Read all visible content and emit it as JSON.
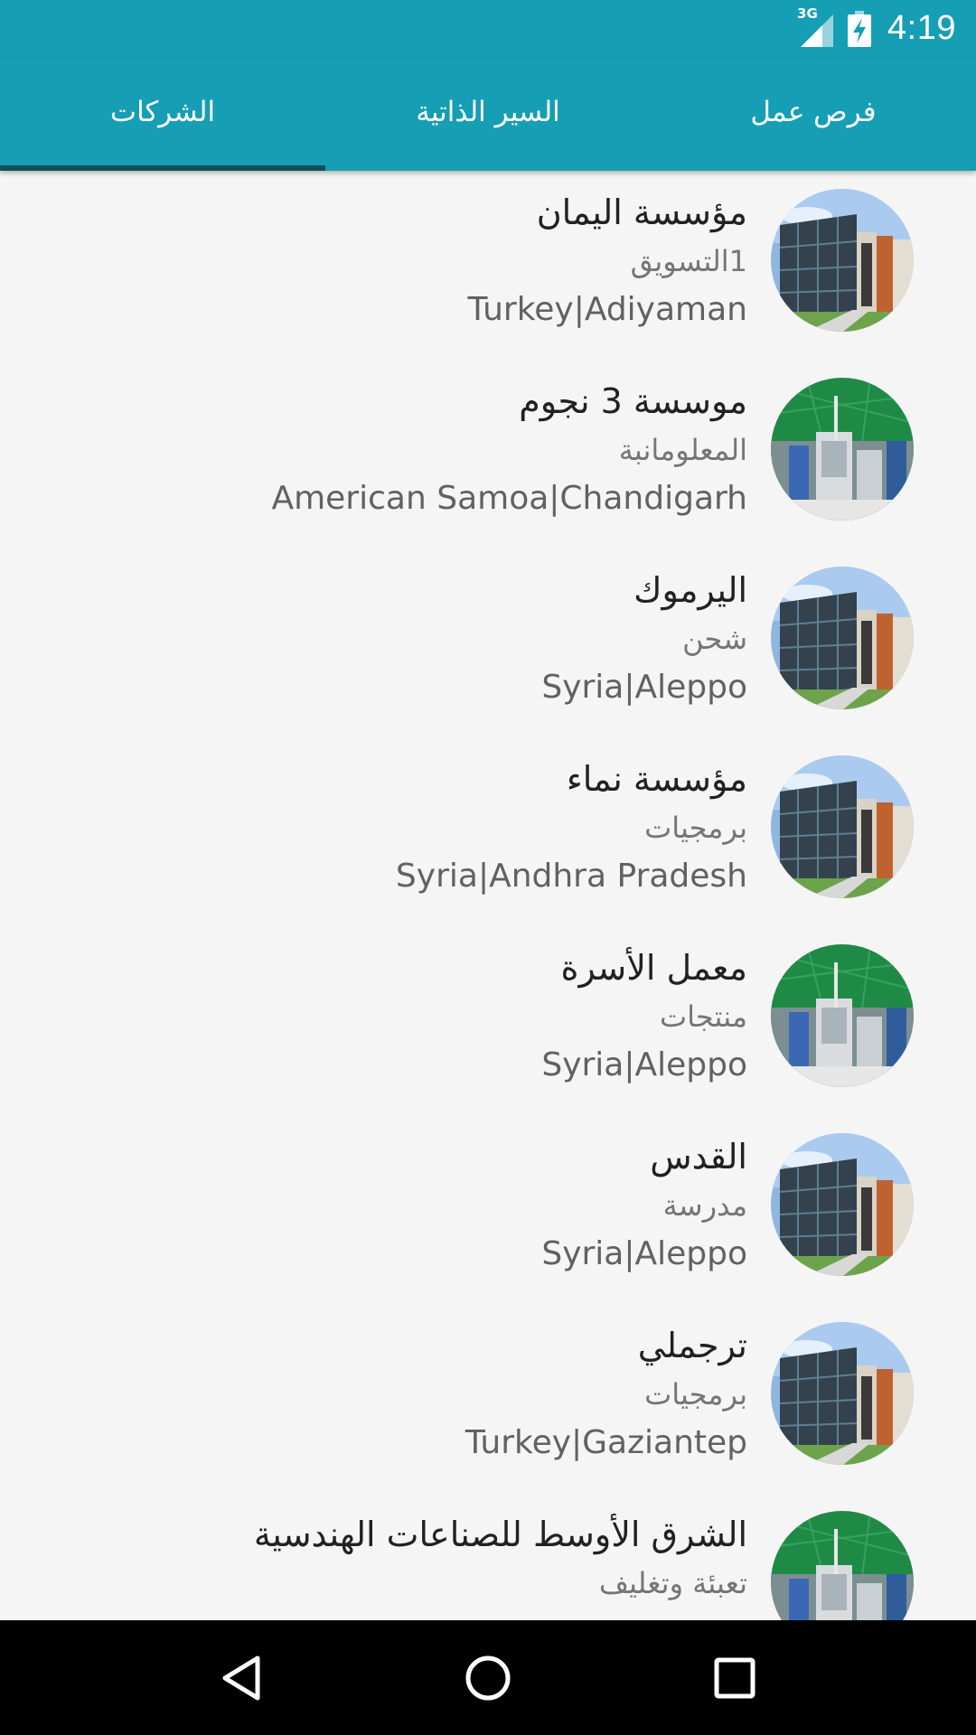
{
  "status_bar": {
    "network_label": "3G",
    "time": "4:19"
  },
  "tabs": [
    {
      "label": "فرص عمل",
      "active": false
    },
    {
      "label": "السير الذاتية",
      "active": false
    },
    {
      "label": "الشركات",
      "active": true
    }
  ],
  "companies": [
    {
      "name": "مؤسسة اليمان",
      "category": "1التسويق",
      "location": "Turkey|Adiyaman",
      "image": "office-building"
    },
    {
      "name": "موسسة 3 نجوم",
      "category": "المعلومانبة",
      "location": "American Samoa|Chandigarh",
      "image": "factory-interior"
    },
    {
      "name": "اليرموك",
      "category": "شحن",
      "location": "Syria|Aleppo",
      "image": "office-building"
    },
    {
      "name": "مؤسسة نماء",
      "category": "برمجيات",
      "location": "Syria|Andhra Pradesh",
      "image": "office-building"
    },
    {
      "name": "معمل الأسرة",
      "category": "منتجات",
      "location": "Syria|Aleppo",
      "image": "factory-interior"
    },
    {
      "name": "القدس",
      "category": "مدرسة",
      "location": "Syria|Aleppo",
      "image": "office-building"
    },
    {
      "name": "ترجملي",
      "category": "برمجيات",
      "location": "Turkey|Gaziantep",
      "image": "office-building"
    },
    {
      "name": "الشرق الأوسط للصناعات الهندسية",
      "category": "تعبئة وتغليف",
      "location": "",
      "image": "factory-interior"
    }
  ],
  "colors": {
    "primary": "#169eb4",
    "tab_indicator": "#0d4f5c",
    "background": "#f5f5f5",
    "name_text": "#212121",
    "secondary_text": "#757575"
  },
  "nav_bar": {
    "icons": [
      "back-icon",
      "home-icon",
      "recents-icon"
    ]
  }
}
